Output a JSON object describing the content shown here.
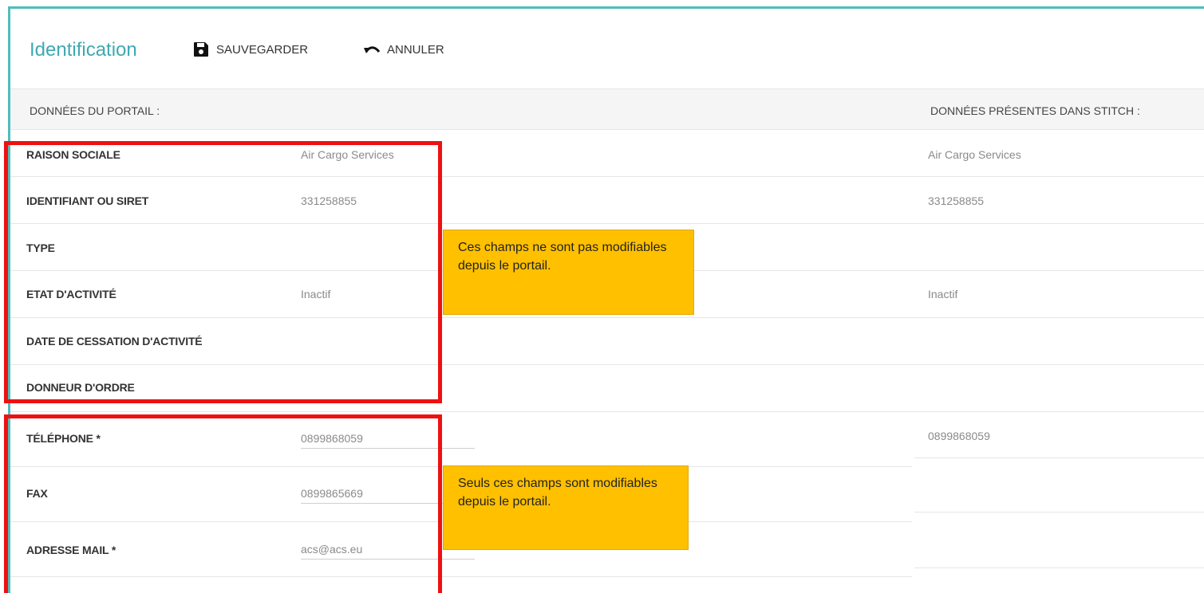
{
  "toolbar": {
    "title": "Identification",
    "save_label": "SAUVEGARDER",
    "cancel_label": "ANNULER"
  },
  "section": {
    "left_header": "DONNÉES DU PORTAIL :",
    "right_header": "DONNÉES PRÉSENTES DANS STITCH :"
  },
  "readonly_fields": [
    {
      "label": "RAISON SOCIALE",
      "portal_value": "Air Cargo Services",
      "stitch_value": "Air Cargo Services"
    },
    {
      "label": "IDENTIFIANT OU SIRET",
      "portal_value": "331258855",
      "stitch_value": "331258855"
    },
    {
      "label": "TYPE",
      "portal_value": "",
      "stitch_value": ""
    },
    {
      "label": "ETAT D'ACTIVITÉ",
      "portal_value": "Inactif",
      "stitch_value": "Inactif"
    },
    {
      "label": "DATE DE CESSATION D'ACTIVITÉ",
      "portal_value": "",
      "stitch_value": ""
    },
    {
      "label": "DONNEUR D'ORDRE",
      "portal_value": "",
      "stitch_value": ""
    }
  ],
  "editable_fields": [
    {
      "label": "TÉLÉPHONE *",
      "value": "0899868059",
      "stitch_value": "0899868059"
    },
    {
      "label": "FAX",
      "value": "0899865669",
      "stitch_value": ""
    },
    {
      "label": "ADRESSE MAIL *",
      "value": "acs@acs.eu",
      "stitch_value": ""
    }
  ],
  "notes": {
    "readonly": "Ces champs ne sont pas modifiables depuis le portail.",
    "editable": "Seuls ces champs sont modifiables depuis le portail."
  },
  "colors": {
    "accent": "#3fa9b0",
    "frame": "#4fbdbd",
    "highlight_box": "#ee1111",
    "note_bg": "#ffc000"
  }
}
